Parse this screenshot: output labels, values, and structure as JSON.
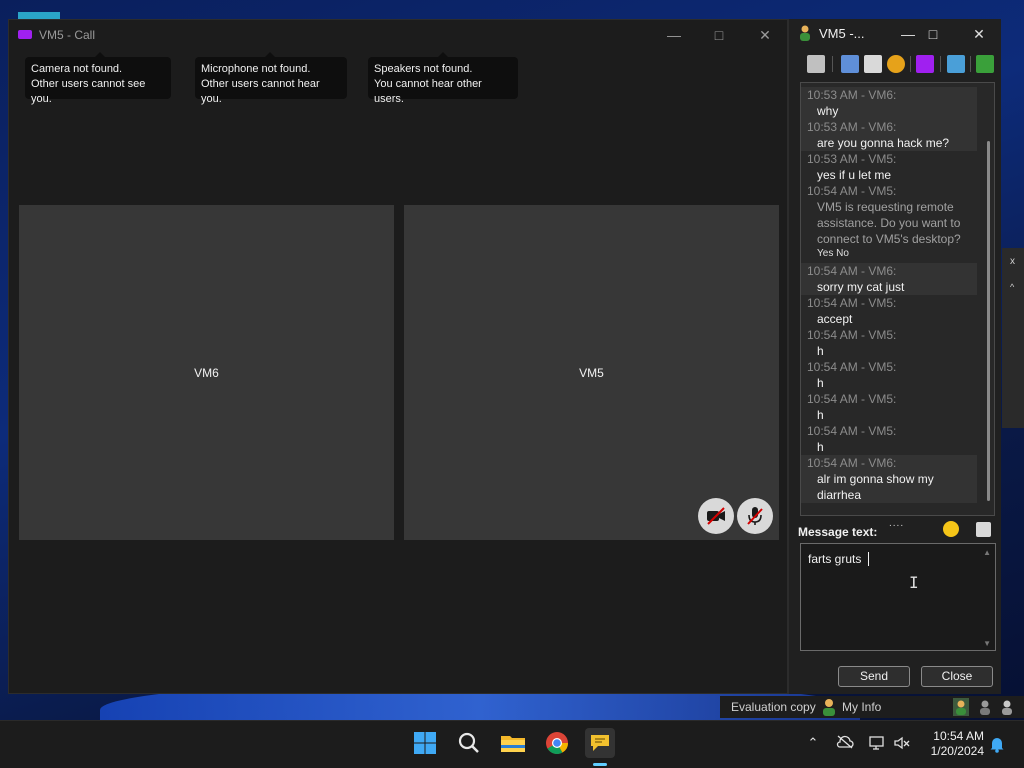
{
  "call_window": {
    "title": "VM5 - Call",
    "notices": [
      {
        "line1": "Camera not found.",
        "line2": "Other users cannot see you."
      },
      {
        "line1": "Microphone not found.",
        "line2": "Other users cannot hear you."
      },
      {
        "line1": "Speakers not found.",
        "line2": "You cannot hear other users."
      }
    ],
    "tiles": [
      {
        "label": "VM6"
      },
      {
        "label": "VM5"
      }
    ],
    "camera_enabled": false,
    "microphone_enabled": false
  },
  "chat_window": {
    "title": "VM5 -...",
    "messages": [
      {
        "header": "10:53 AM - VM6:",
        "text": "why"
      },
      {
        "header": "10:53 AM - VM6:",
        "text": "are you gonna hack me?"
      },
      {
        "header": "10:53 AM - VM5:",
        "text": "yes if u let me"
      },
      {
        "header": "10:54 AM - VM5:",
        "text_lines": [
          "VM5 is requesting remote",
          "assistance. Do you want to",
          "connect to VM5's desktop?"
        ],
        "actions": "Yes No"
      },
      {
        "header": "10:54 AM - VM6:",
        "text": "sorry my cat just"
      },
      {
        "header": "10:54 AM - VM5:",
        "text": "accept"
      },
      {
        "header": "10:54 AM - VM5:",
        "text": "h"
      },
      {
        "header": "10:54 AM - VM5:",
        "text": "h"
      },
      {
        "header": "10:54 AM - VM5:",
        "text": "h"
      },
      {
        "header": "10:54 AM - VM5:",
        "text": "h"
      },
      {
        "header": "10:54 AM - VM6:",
        "text_lines": [
          "alr im gonna show my",
          "diarrhea"
        ]
      }
    ],
    "message_label": "Message text:",
    "compose_value": "farts gruts",
    "send_label": "Send",
    "close_label": "Close"
  },
  "status_bar": {
    "evaluation": "Evaluation copy",
    "my_info": "My Info"
  },
  "taskbar": {
    "time": "10:54 AM",
    "date": "1/20/2024",
    "apps": [
      "windows-start",
      "search",
      "file-explorer",
      "chrome",
      "chat-app"
    ]
  },
  "colors": {
    "call_bg": "#1c1c1c",
    "tile_bg": "#373737",
    "chat_bg": "#202020",
    "accent_purple": "#a020f0",
    "taskbar_active": "#60cdff"
  }
}
